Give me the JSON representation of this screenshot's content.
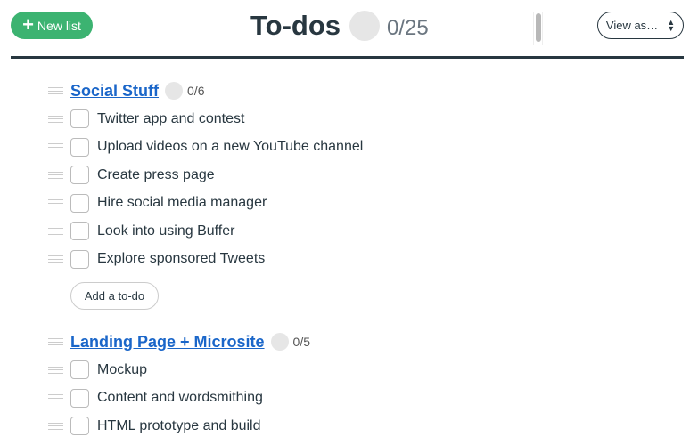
{
  "header": {
    "new_list_label": "New list",
    "new_list_icon": "plus-icon",
    "title": "To-dos",
    "progress": "0/25",
    "view_as": "View as…"
  },
  "lists": [
    {
      "title": "Social Stuff",
      "progress": "0/6",
      "add_label": "Add a to-do",
      "items": [
        "Twitter app and contest",
        "Upload videos on a new YouTube channel",
        "Create press page",
        "Hire social media manager",
        "Look into using Buffer",
        "Explore sponsored Tweets"
      ]
    },
    {
      "title": "Landing Page + Microsite",
      "progress": "0/5",
      "items": [
        "Mockup",
        "Content and wordsmithing",
        "HTML prototype and build"
      ]
    }
  ],
  "colors": {
    "accent_green": "#3cb371",
    "link_blue": "#1a66c9",
    "text": "#283740"
  }
}
